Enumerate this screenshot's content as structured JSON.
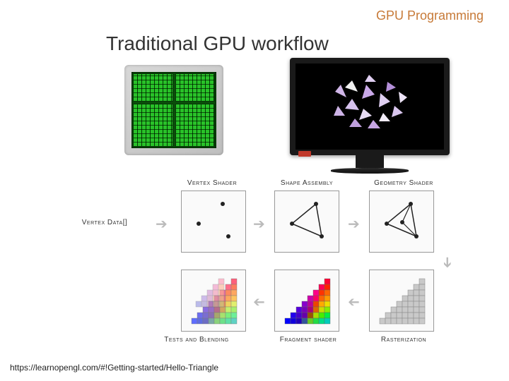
{
  "header": {
    "title": "GPU Programming"
  },
  "slide": {
    "title": "Traditional GPU workflow"
  },
  "pipeline": {
    "input_label": "Vertex Data[]",
    "stages_top": [
      {
        "label": "Vertex Shader"
      },
      {
        "label": "Shape Assembly"
      },
      {
        "label": "Geometry Shader"
      }
    ],
    "stages_bottom": [
      {
        "label": "Tests and Blending"
      },
      {
        "label": "Fragment shader"
      },
      {
        "label": "Rasterization"
      }
    ]
  },
  "footer": {
    "source": "https://learnopengl.com/#!Getting-started/Hello-Triangle"
  }
}
